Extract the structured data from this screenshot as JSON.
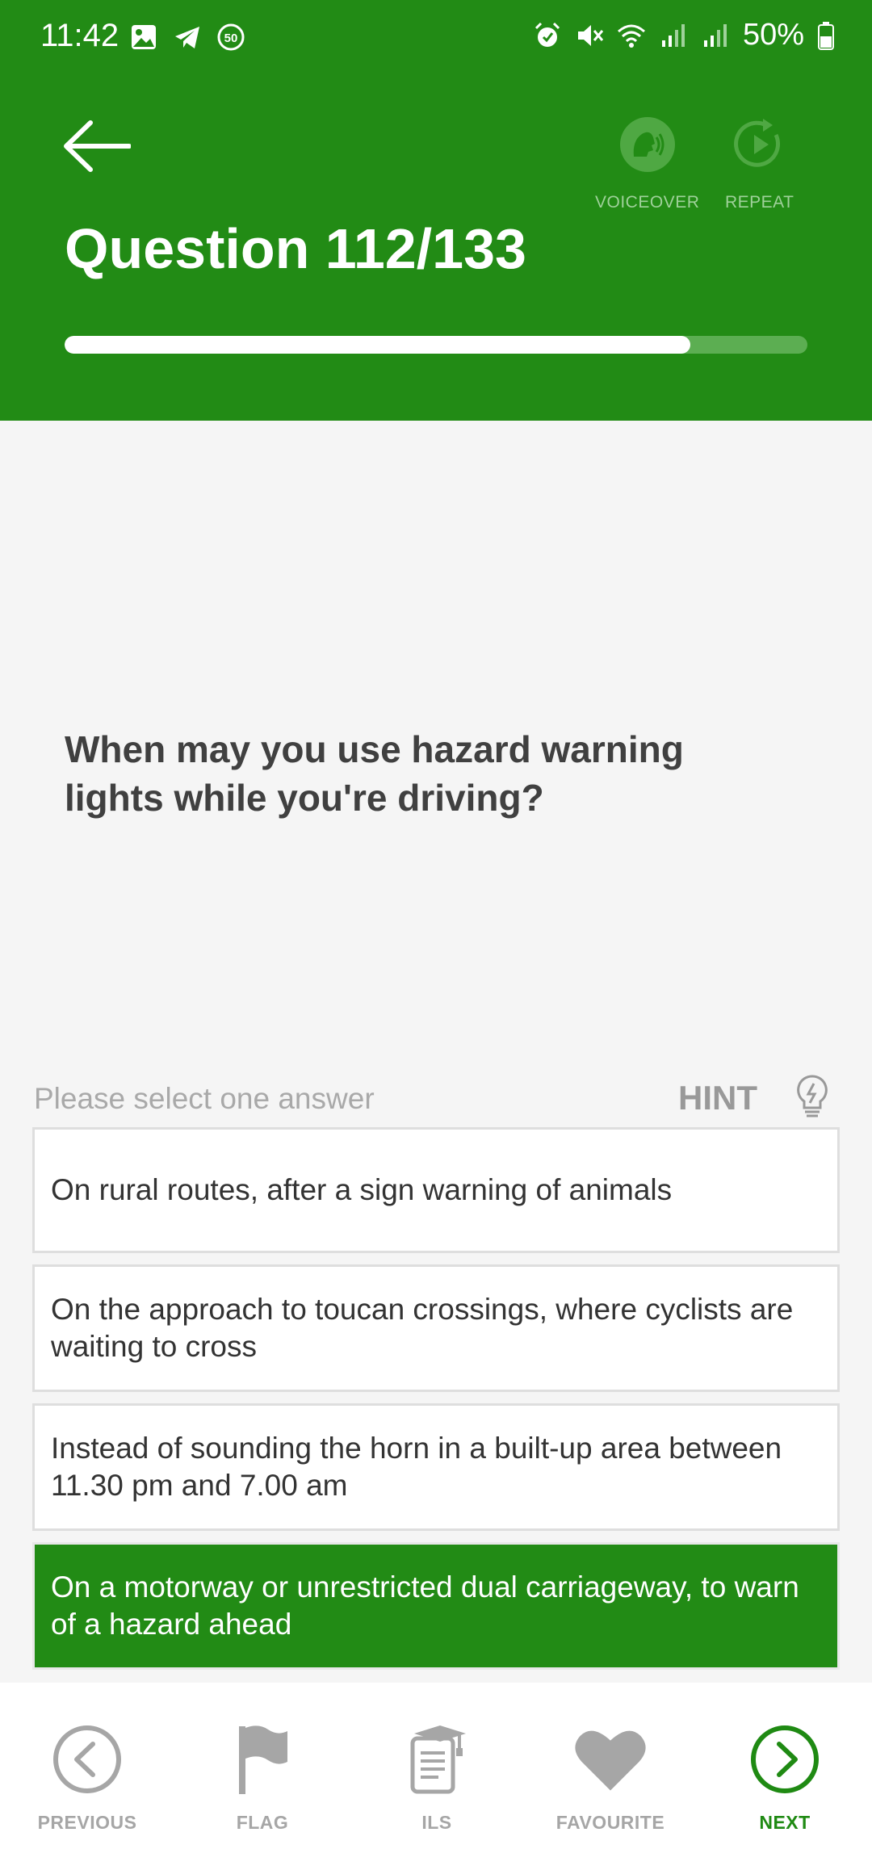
{
  "status_bar": {
    "time": "11:42",
    "notification_badge": "50",
    "battery": "50%",
    "icons": [
      "image-icon",
      "telegram-icon",
      "badge-50-icon",
      "alarm-icon",
      "mute-icon",
      "wifi-icon",
      "signal-icon",
      "signal-icon",
      "battery-icon"
    ]
  },
  "header": {
    "title": "Question 112/133",
    "voiceover_label": "VOICEOVER",
    "repeat_label": "REPEAT",
    "progress": {
      "current": 112,
      "total": 133
    },
    "colors": {
      "primary": "#228b15",
      "progress_track": "#5cae52",
      "progress_fill": "#ffffff"
    }
  },
  "question": {
    "text": "When may you use hazard warning lights while you're driving?"
  },
  "answers_section": {
    "instruction": "Please select one answer",
    "hint_label": "HINT",
    "options": [
      {
        "text": "On rural routes, after a sign warning of animals",
        "selected": false
      },
      {
        "text": "On the approach to toucan crossings, where cyclists are waiting to cross",
        "selected": false
      },
      {
        "text": "Instead of sounding the horn in a built-up area between 11.30 pm and 7.00 am",
        "selected": false
      },
      {
        "text": "On a motorway or unrestricted dual carriageway, to warn of a hazard ahead",
        "selected": true
      }
    ]
  },
  "bottom_nav": {
    "previous_label": "PREVIOUS",
    "flag_label": "FLAG",
    "ils_label": "ILS",
    "favourite_label": "FAVOURITE",
    "next_label": "NEXT",
    "colors": {
      "inactive": "#a6a6a6",
      "active": "#1f8a13"
    }
  }
}
